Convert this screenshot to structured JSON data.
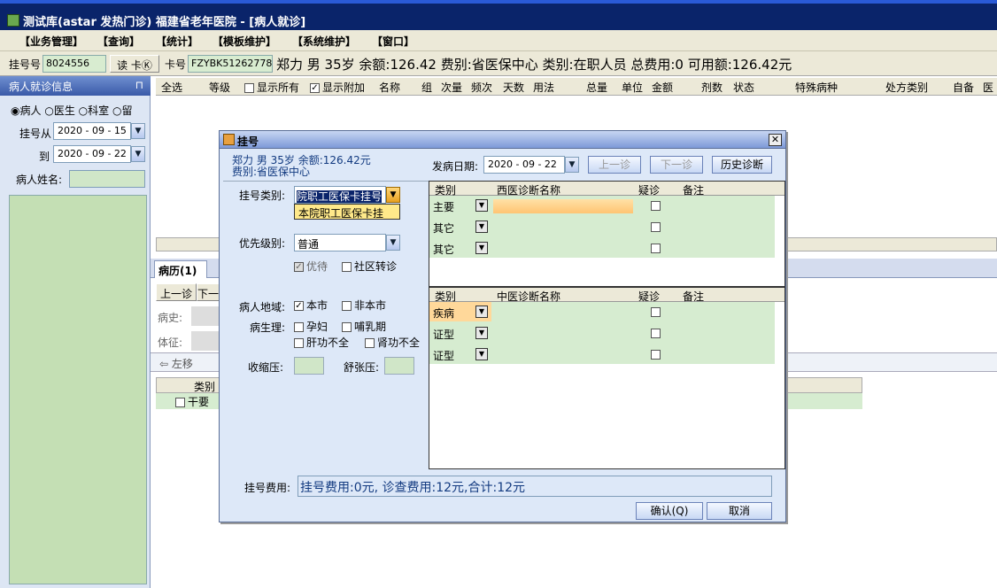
{
  "window": {
    "title": "测试库(astar 发热门诊) 福建省老年医院 - [病人就诊]"
  },
  "menu": [
    "【业务管理】",
    "【查询】",
    "【统计】",
    "【模板维护】",
    "【系统维护】",
    "【窗口】"
  ],
  "infobar": {
    "reg_no_label": "挂号号",
    "reg_no_value": "8024556",
    "read_card_label": "读 卡",
    "read_card_key": "Ⓚ",
    "card_no_label": "卡号",
    "card_no_value": "FZYBK51262778",
    "patient_summary": "郑力 男 35岁 余额:126.42 费别:省医保中心 类别:在职人员 总费用:0 可用额:126.42元"
  },
  "left_panel": {
    "title": "病人就诊信息",
    "pin": "⊓",
    "radios": [
      "病人",
      "医生",
      "科室",
      "留"
    ],
    "reg_from_label": "挂号从",
    "reg_from_value": "2020 - 09 - 15",
    "reg_to_label": "到",
    "reg_to_value": "2020 - 09 - 22",
    "name_label": "病人姓名:"
  },
  "table_header": {
    "select_all": "全选",
    "level": "等级",
    "show_all": "显示所有",
    "show_extra": "显示附加",
    "columns": [
      "名称",
      "组",
      "次量",
      "频次",
      "天数",
      "用法",
      "总量",
      "单位",
      "金额",
      "剂数",
      "状态",
      "特殊病种",
      "处方类别",
      "自备",
      "医"
    ]
  },
  "lower": {
    "tab_label": "病历",
    "tab_key": "(1)",
    "prev_label": "上一诊",
    "next_label": "下一",
    "history_label": "病史:",
    "sign_label": "体征:",
    "move_left": "左移",
    "grid_col": "类别",
    "grid_row": "干要"
  },
  "dialog": {
    "title": "挂号",
    "close": "✕",
    "patient_line1": "郑力 男 35岁 余额:126.42元",
    "patient_line2": "费别:省医保中心",
    "onset_label": "发病日期:",
    "onset_value": "2020 - 09 - 22",
    "prev_visit": "上一诊",
    "next_visit": "下一诊",
    "history_diag": "历史诊断",
    "reg_type_label": "挂号类别:",
    "reg_type_value": "院职工医保卡挂号",
    "reg_type_option": "本院职工医保卡挂",
    "priority_label": "优先级别:",
    "priority_value": "普通",
    "preferential": "优待",
    "community": "社区转诊",
    "region_label": "病人地域:",
    "local": "本市",
    "nonlocal": "非本市",
    "physio_label": "病生理:",
    "pregnant": "孕妇",
    "lactation": "哺乳期",
    "liver": "肝功不全",
    "kidney": "肾功不全",
    "systolic_label": "收缩压:",
    "diastolic_label": "舒张压:",
    "western_grid": {
      "headers": [
        "类别",
        "西医诊断名称",
        "疑诊",
        "备注"
      ],
      "rows": [
        "主要",
        "其它",
        "其它"
      ]
    },
    "tcm_grid": {
      "headers": [
        "类别",
        "中医诊断名称",
        "疑诊",
        "备注"
      ],
      "rows": [
        "疾病",
        "证型",
        "证型"
      ]
    },
    "fee_label": "挂号费用:",
    "fee_value": "挂号费用:0元, 诊查费用:12元,合计:12元",
    "ok": "确认(Q)",
    "cancel": "取消"
  }
}
